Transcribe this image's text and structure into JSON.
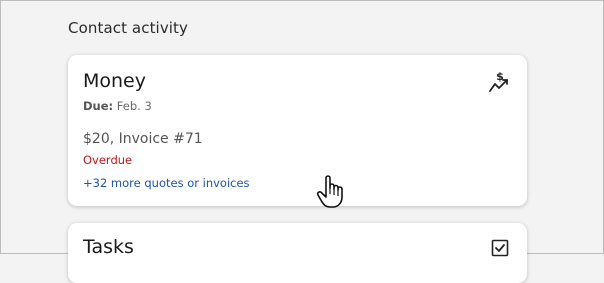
{
  "section": {
    "title": "Contact activity"
  },
  "money_card": {
    "title": "Money",
    "due_label": "Due:",
    "due_value": "Feb. 3",
    "amount": "$20, Invoice #71",
    "status": "Overdue",
    "more_link": "+32 more quotes or invoices",
    "icon": "money-trend-icon"
  },
  "tasks_card": {
    "title": "Tasks",
    "icon": "checkbox-icon"
  },
  "colors": {
    "status_overdue": "#c0161a",
    "link": "#1f51b6",
    "background": "#f3f3f3",
    "card": "#ffffff"
  },
  "cursor": {
    "icon": "hand-pointer-icon"
  }
}
